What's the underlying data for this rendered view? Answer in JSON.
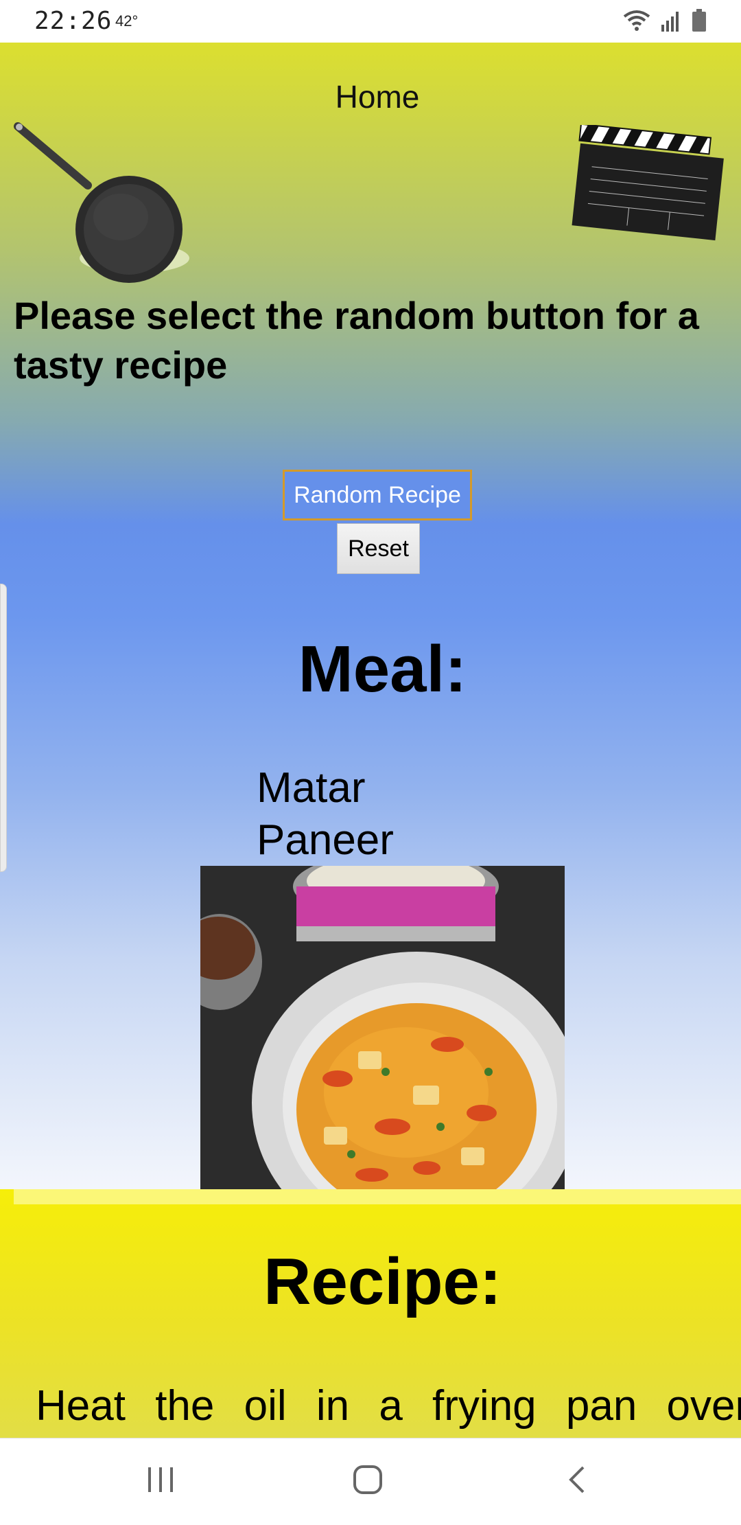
{
  "status_bar": {
    "time": "22:26",
    "temperature": "42°",
    "icons": [
      "wifi-icon",
      "signal-icon",
      "battery-icon"
    ]
  },
  "header": {
    "home_link": "Home",
    "left_image": "frying-pan",
    "right_image": "movie-clapperboard"
  },
  "main": {
    "prompt": "Please select the random button for a tasty recipe",
    "random_button": "Random Recipe",
    "reset_button": "Reset",
    "meal_heading": "Meal:",
    "meal_name": "Matar Paneer",
    "meal_image": "matar-paneer-dish-photo"
  },
  "recipe": {
    "heading": "Recipe:",
    "text_first_line": "Heat the oil in a frying pan over"
  },
  "navigation_bar": {
    "buttons": [
      "recent-apps-icon",
      "home-icon",
      "back-icon"
    ]
  },
  "colors": {
    "button_accent": "#6590ea",
    "button_border": "#d49a2a",
    "recipe_band": "#f6ee09"
  }
}
